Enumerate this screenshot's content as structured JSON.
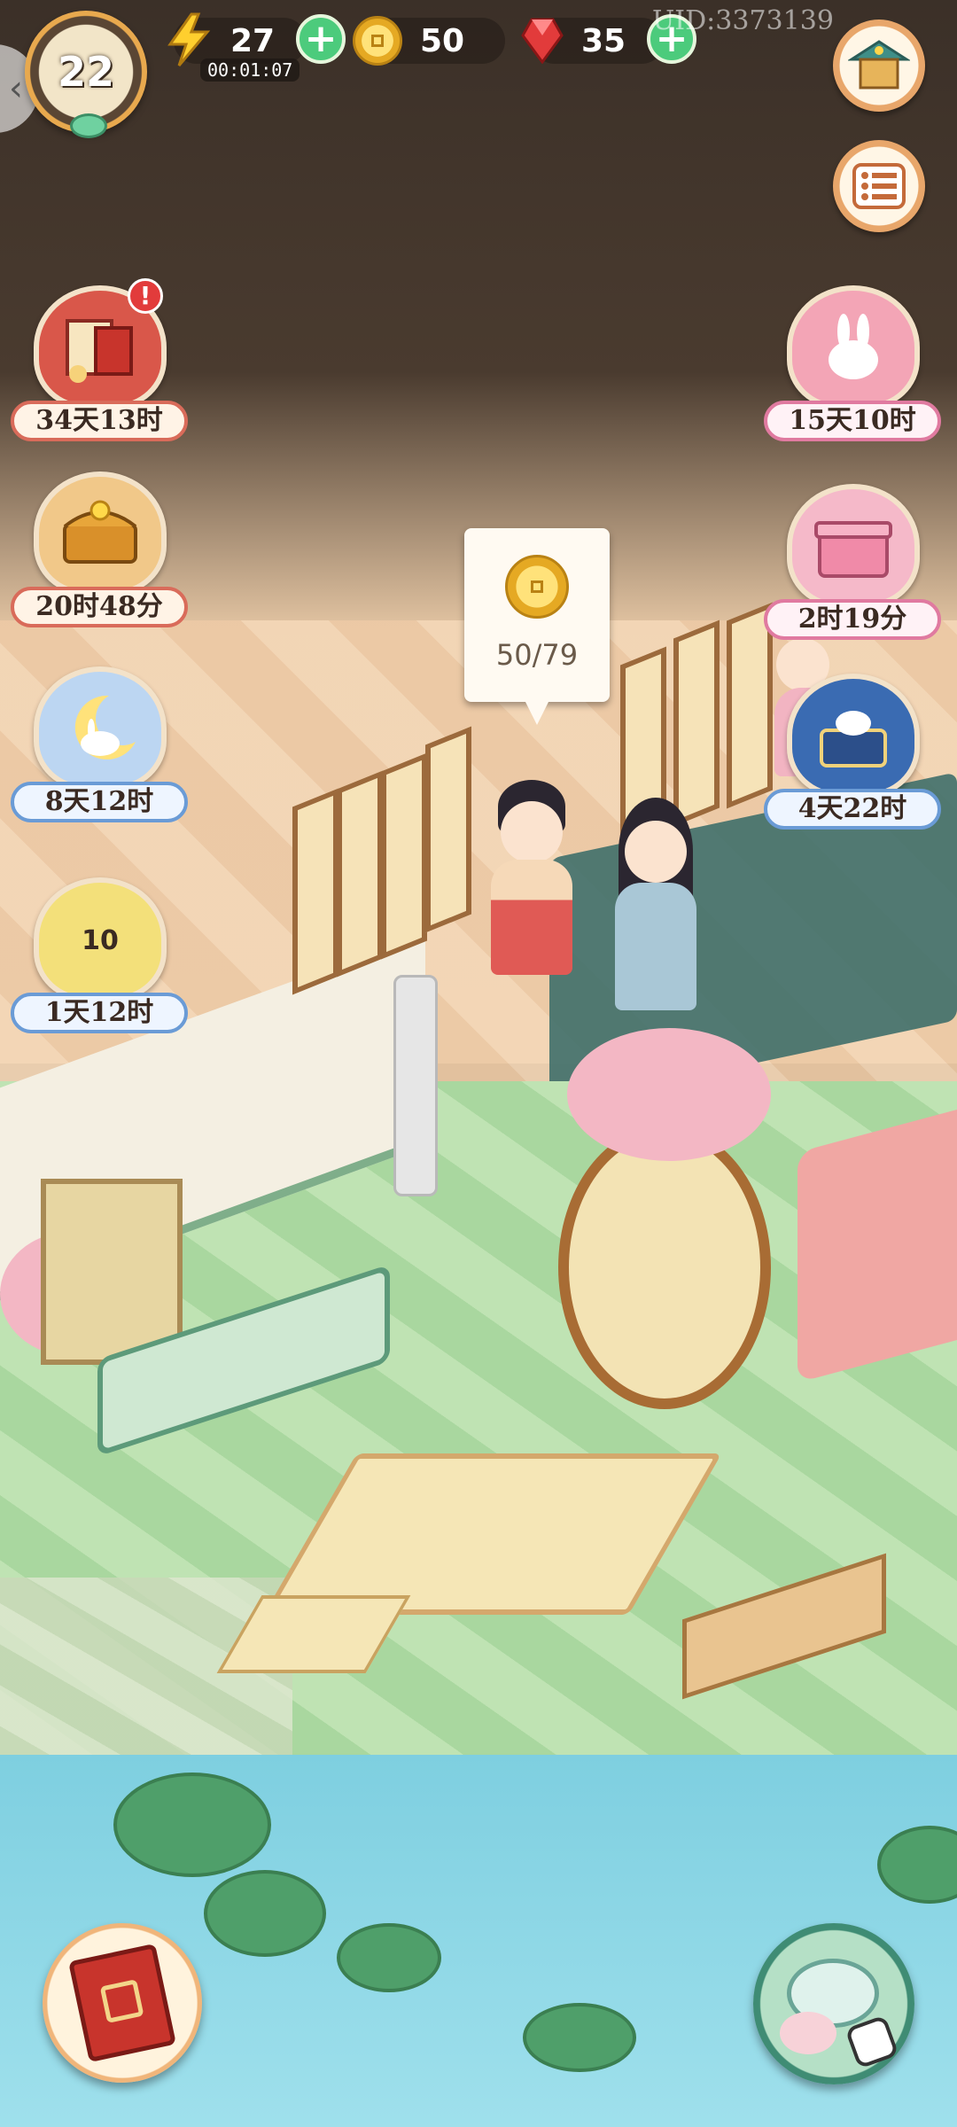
{
  "hud": {
    "level": "22",
    "energy": {
      "value": "27",
      "timer": "00:01:07",
      "icon": "lightning-icon"
    },
    "coins": {
      "value": "50",
      "icon": "gold-coin-icon"
    },
    "gems": {
      "value": "35",
      "icon": "red-gem-icon"
    },
    "uid": "UID:3373139",
    "colors": {
      "plus": "#4ccb7c",
      "pill": "#28201a"
    }
  },
  "events_left": [
    {
      "label": "34天13时",
      "icon": "scroll-gift-icon",
      "has_alert": true,
      "alert": "!"
    },
    {
      "label": "20时48分",
      "icon": "treasure-chest-icon"
    },
    {
      "label": "8天12时",
      "icon": "moon-rabbit-icon"
    },
    {
      "label": "1天12时",
      "icon": "lantern-badge-icon",
      "badge": "10"
    }
  ],
  "events_right": [
    {
      "label": "15天10时",
      "icon": "rabbit-flower-icon"
    },
    {
      "label": "2时19分",
      "icon": "pink-gift-box-icon"
    },
    {
      "label": "4天22时",
      "icon": "rabbit-chest-icon"
    }
  ],
  "tooltip": {
    "progress": "50/79",
    "icon": "gold-coin-icon"
  },
  "bottom": {
    "left_icon": "storybook-icon",
    "right_icon": "teapot-bunny-icon"
  }
}
